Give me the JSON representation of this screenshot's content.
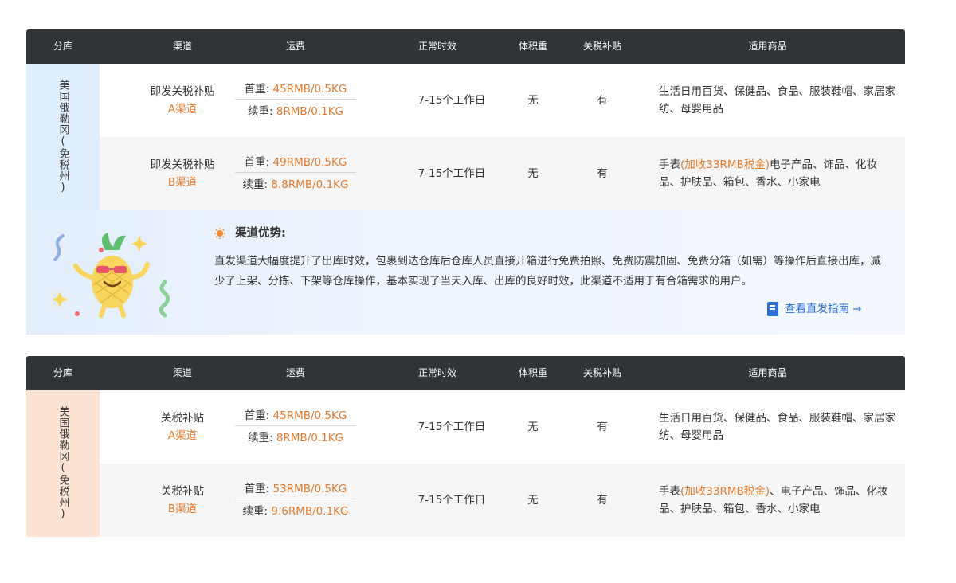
{
  "colors": {
    "header_bg": "#303437",
    "accent": "#e47a2c",
    "link": "#2a6fd6",
    "wh_blue": "#dfeefd",
    "wh_peach": "#fde3d4"
  },
  "headers": {
    "c1": "分库",
    "c2": "渠道",
    "c3": "运费",
    "c4": "正常时效",
    "c5": "体积重",
    "c6": "关税补贴",
    "c7": "适用商品"
  },
  "table1": {
    "warehouse": "美国俄勒冈(免税州)",
    "rows": [
      {
        "name": "即发关税补贴",
        "tag": "A渠道",
        "first_label": "首重:",
        "first_val": "45RMB/0.5KG",
        "cont_label": "续重:",
        "cont_val": "8RMB/0.1KG",
        "time": "7-15个工作日",
        "volume": "无",
        "tax": "有",
        "goods_pre": "",
        "goods_hl": "",
        "goods_post": "生活日用百货、保健品、食品、服装鞋帽、家居家纺、母婴用品"
      },
      {
        "name": "即发关税补贴",
        "tag": "B渠道",
        "first_label": "首重:",
        "first_val": "49RMB/0.5KG",
        "cont_label": "续重:",
        "cont_val": "8.8RMB/0.1KG",
        "time": "7-15个工作日",
        "volume": "无",
        "tax": "有",
        "goods_pre": "手表",
        "goods_hl": "(加收33RMB税金)",
        "goods_post": "电子产品、饰品、化妆品、护肤品、箱包、香水、小家电"
      }
    ],
    "advantage": {
      "title": "渠道优势:",
      "body": "直发渠道大幅度提升了出库时效，包裹到达仓库后仓库人员直接开箱进行免费拍照、免费防震加固、免费分箱（如需）等操作后直接出库，减少了上架、分拣、下架等仓库操作，基本实现了当天入库、出库的良好时效，此渠道不适用于有合箱需求的用户。",
      "link": "查看直发指南 →"
    }
  },
  "table2": {
    "warehouse": "美国俄勒冈(免税州)",
    "rows": [
      {
        "name": "关税补贴",
        "tag": "A渠道",
        "first_label": "首重:",
        "first_val": "45RMB/0.5KG",
        "cont_label": "续重:",
        "cont_val": "8RMB/0.1KG",
        "time": "7-15个工作日",
        "volume": "无",
        "tax": "有",
        "goods_pre": "",
        "goods_hl": "",
        "goods_post": "生活日用百货、保健品、食品、服装鞋帽、家居家纺、母婴用品"
      },
      {
        "name": "关税补贴",
        "tag": "B渠道",
        "first_label": "首重:",
        "first_val": "53RMB/0.5KG",
        "cont_label": "续重:",
        "cont_val": "9.6RMB/0.1KG",
        "time": "7-15个工作日",
        "volume": "无",
        "tax": "有",
        "goods_pre": "手表",
        "goods_hl": "(加收33RMB税金)",
        "goods_post": "、电子产品、饰品、化妆品、护肤品、箱包、香水、小家电"
      }
    ]
  }
}
